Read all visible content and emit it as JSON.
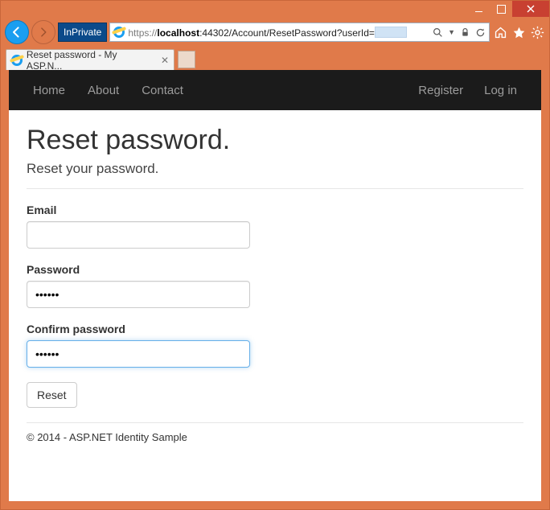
{
  "window": {
    "inprivate_label": "InPrivate",
    "url_proto": "https://",
    "url_host": "localhost",
    "url_port_path": ":44302/Account/ResetPassword?userId=",
    "tab_title": "Reset password - My ASP.N..."
  },
  "nav": {
    "left": [
      "Home",
      "About",
      "Contact"
    ],
    "right": [
      "Register",
      "Log in"
    ]
  },
  "page": {
    "heading": "Reset password.",
    "subheading": "Reset your password.",
    "email_label": "Email",
    "email_value": "",
    "password_label": "Password",
    "password_value": "••••••",
    "confirm_label": "Confirm password",
    "confirm_value": "••••••",
    "reset_button": "Reset",
    "footer": "© 2014 - ASP.NET Identity Sample"
  }
}
